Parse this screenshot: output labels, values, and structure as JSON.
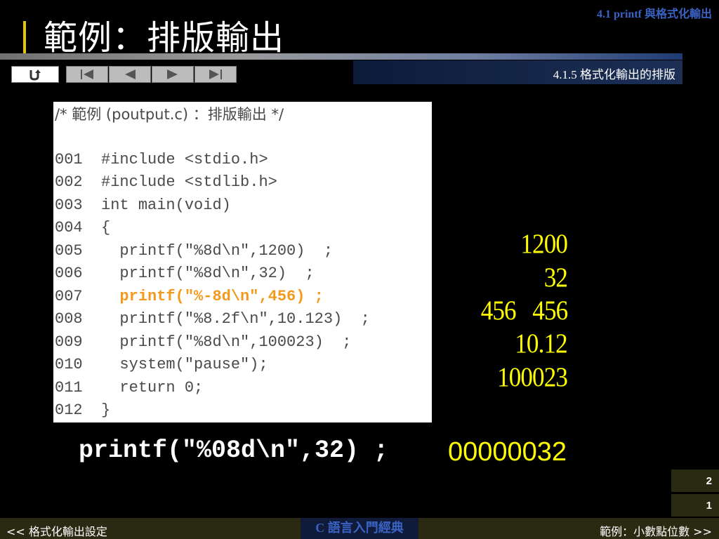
{
  "header": {
    "chapter": "4.1  printf 與格式化輸出",
    "title": "範例：排版輸出",
    "subsection": "4.1.5 格式化輸出的排版"
  },
  "nav": {
    "home_icon": "return-icon",
    "buttons": [
      "first-icon",
      "previous-icon",
      "next-icon",
      "last-icon"
    ]
  },
  "code": {
    "comment": "/* 範例 (poutput.c) ：排版輸出 */",
    "lines": [
      {
        "num": "001",
        "text": "  #include <stdio.h>"
      },
      {
        "num": "002",
        "text": "  #include <stdlib.h>"
      },
      {
        "num": "003",
        "text": "  int main(void)"
      },
      {
        "num": "004",
        "text": "  {"
      },
      {
        "num": "005",
        "text": "    printf(\"%8d\\n\",1200)  ;"
      },
      {
        "num": "006",
        "text": "    printf(\"%8d\\n\",32)  ;"
      },
      {
        "num": "007",
        "text": "    printf(\"%-8d\\n\",456) ;"
      },
      {
        "num": "008",
        "text": "    printf(\"%8.2f\\n\",10.123)  ;"
      },
      {
        "num": "009",
        "text": "    printf(\"%8d\\n\",100023)  ;"
      },
      {
        "num": "010",
        "text": "    system(\"pause\");"
      },
      {
        "num": "011",
        "text": "    return 0;"
      },
      {
        "num": "012",
        "text": "  }"
      }
    ],
    "highlight_line": "007",
    "highlight_color": "#f39a1e"
  },
  "output": {
    "lines": [
      "1200",
      "32",
      "456   456",
      "10.12",
      "100023"
    ],
    "color": "#ffff00"
  },
  "example": {
    "code": "printf(\"%08d\\n\",32) ;",
    "result": "00000032"
  },
  "page_numbers": [
    "2",
    "1"
  ],
  "footer": {
    "prev": "<< 格式化輸出設定",
    "center": "C 語言入門經典",
    "next": "範例：小數點位數 >>"
  }
}
